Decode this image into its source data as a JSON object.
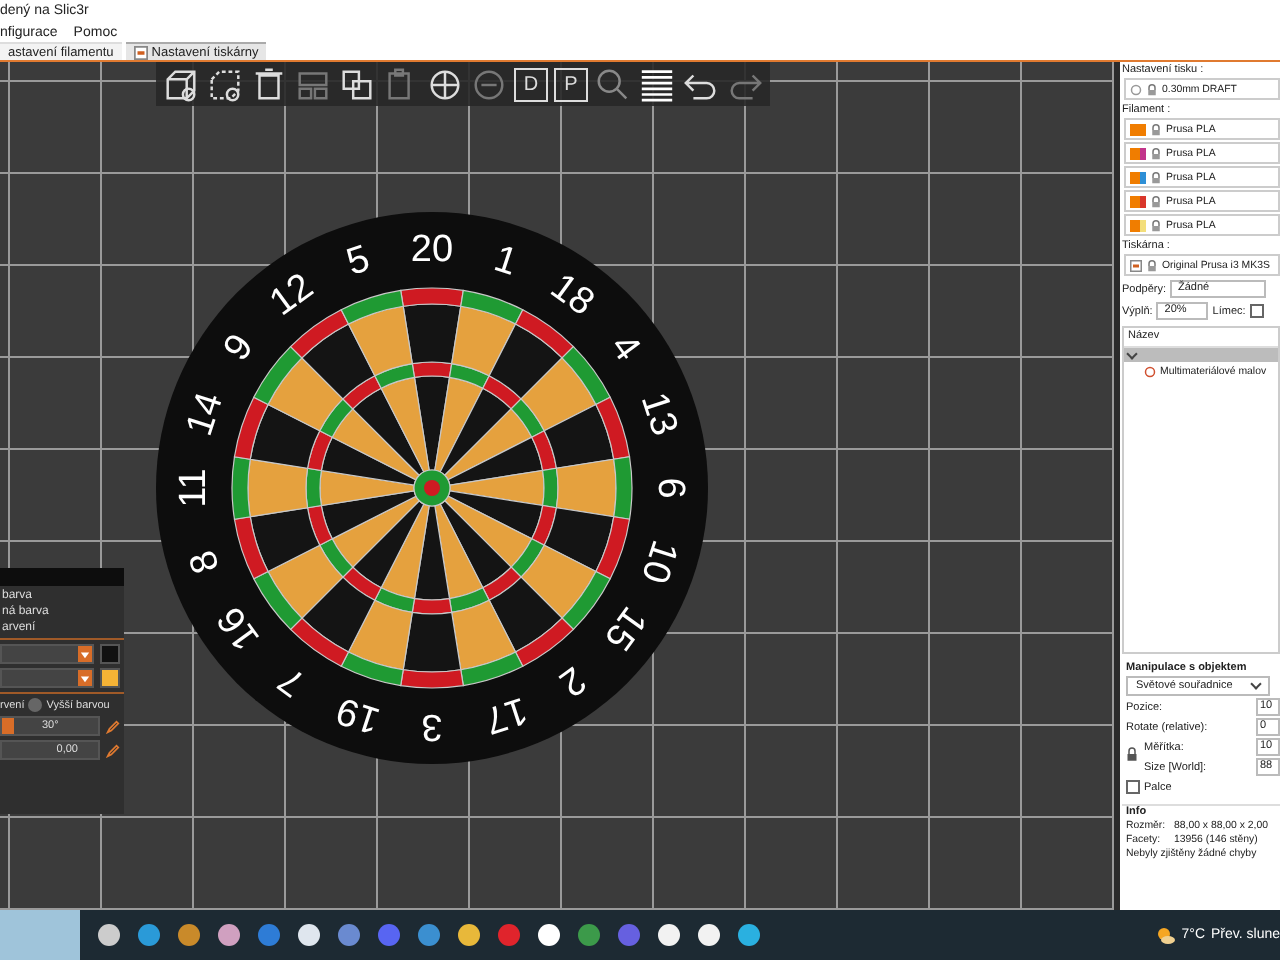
{
  "window": {
    "title": "dený na Slic3r"
  },
  "menu": [
    "nfigurace",
    "Pomoc"
  ],
  "tabs": [
    {
      "label": "astavení filamentu",
      "selected": false
    },
    {
      "label": "Nastavení tiskárny",
      "selected": true
    }
  ],
  "toolbar": {
    "letters": [
      "D",
      "P"
    ]
  },
  "dartboard": {
    "numbers": [
      "20",
      "1",
      "18",
      "4",
      "13",
      "6",
      "10",
      "15",
      "2",
      "17",
      "3",
      "19",
      "7",
      "16",
      "8",
      "11",
      "14",
      "9",
      "12",
      "5"
    ]
  },
  "color_panel": {
    "lines": [
      "barva",
      "ná barva",
      "arvení"
    ],
    "swatches": [
      {
        "color": "#111111"
      },
      {
        "color": "#f5b335"
      }
    ],
    "option_label": "rvení",
    "radio_label": "Vyšší barvou",
    "radio_selected": false,
    "angle_value": "30°",
    "angle_slider": {
      "level": 0.12
    },
    "height_value": "0,00"
  },
  "sidebar": {
    "print_label": "Nastavení tisku :",
    "print_value": "0.30mm DRAFT",
    "filament_label": "Filament :",
    "filaments": [
      {
        "name": "Prusa PLA",
        "color": "#f07d00"
      },
      {
        "name": "Prusa PLA",
        "color": "#c2348a"
      },
      {
        "name": "Prusa PLA",
        "color": "#2d8fd6"
      },
      {
        "name": "Prusa PLA",
        "color": "#d9362b"
      },
      {
        "name": "Prusa PLA",
        "color": "#f3de7a"
      }
    ],
    "printer_label": "Tiskárna :",
    "printer_value": "Original Prusa i3 MK3S",
    "supports_label": "Podpěry:",
    "supports_value": "Žádné",
    "infill_label": "Výplň:",
    "infill_value": "20%",
    "brim_label": "Límec:",
    "brim_checked": false,
    "list_header": "Název",
    "tree_child": "Multimateriálové malov",
    "manip_title": "Manipulace s objektem",
    "coords_value": "Světové souřadnice",
    "fields": [
      {
        "label": "Pozice:",
        "value": "10"
      },
      {
        "label": "Rotate (relative):",
        "value": "0"
      },
      {
        "label": "Měřítka:",
        "value": "10"
      },
      {
        "label": "Size [World]:",
        "value": "88"
      }
    ],
    "inches_label": "Palce",
    "inches_checked": false,
    "info_title": "Info",
    "info": [
      {
        "label": "Rozměr:",
        "value": "88,00 x 88,00 x 2,00"
      },
      {
        "label": "Facety:",
        "value": "13956 (146 stěny)"
      }
    ],
    "info_note": "Nebyly zjištěny žádné chyby"
  },
  "taskbar": {
    "temperature": "7°C",
    "weather": "Přev. slune"
  }
}
